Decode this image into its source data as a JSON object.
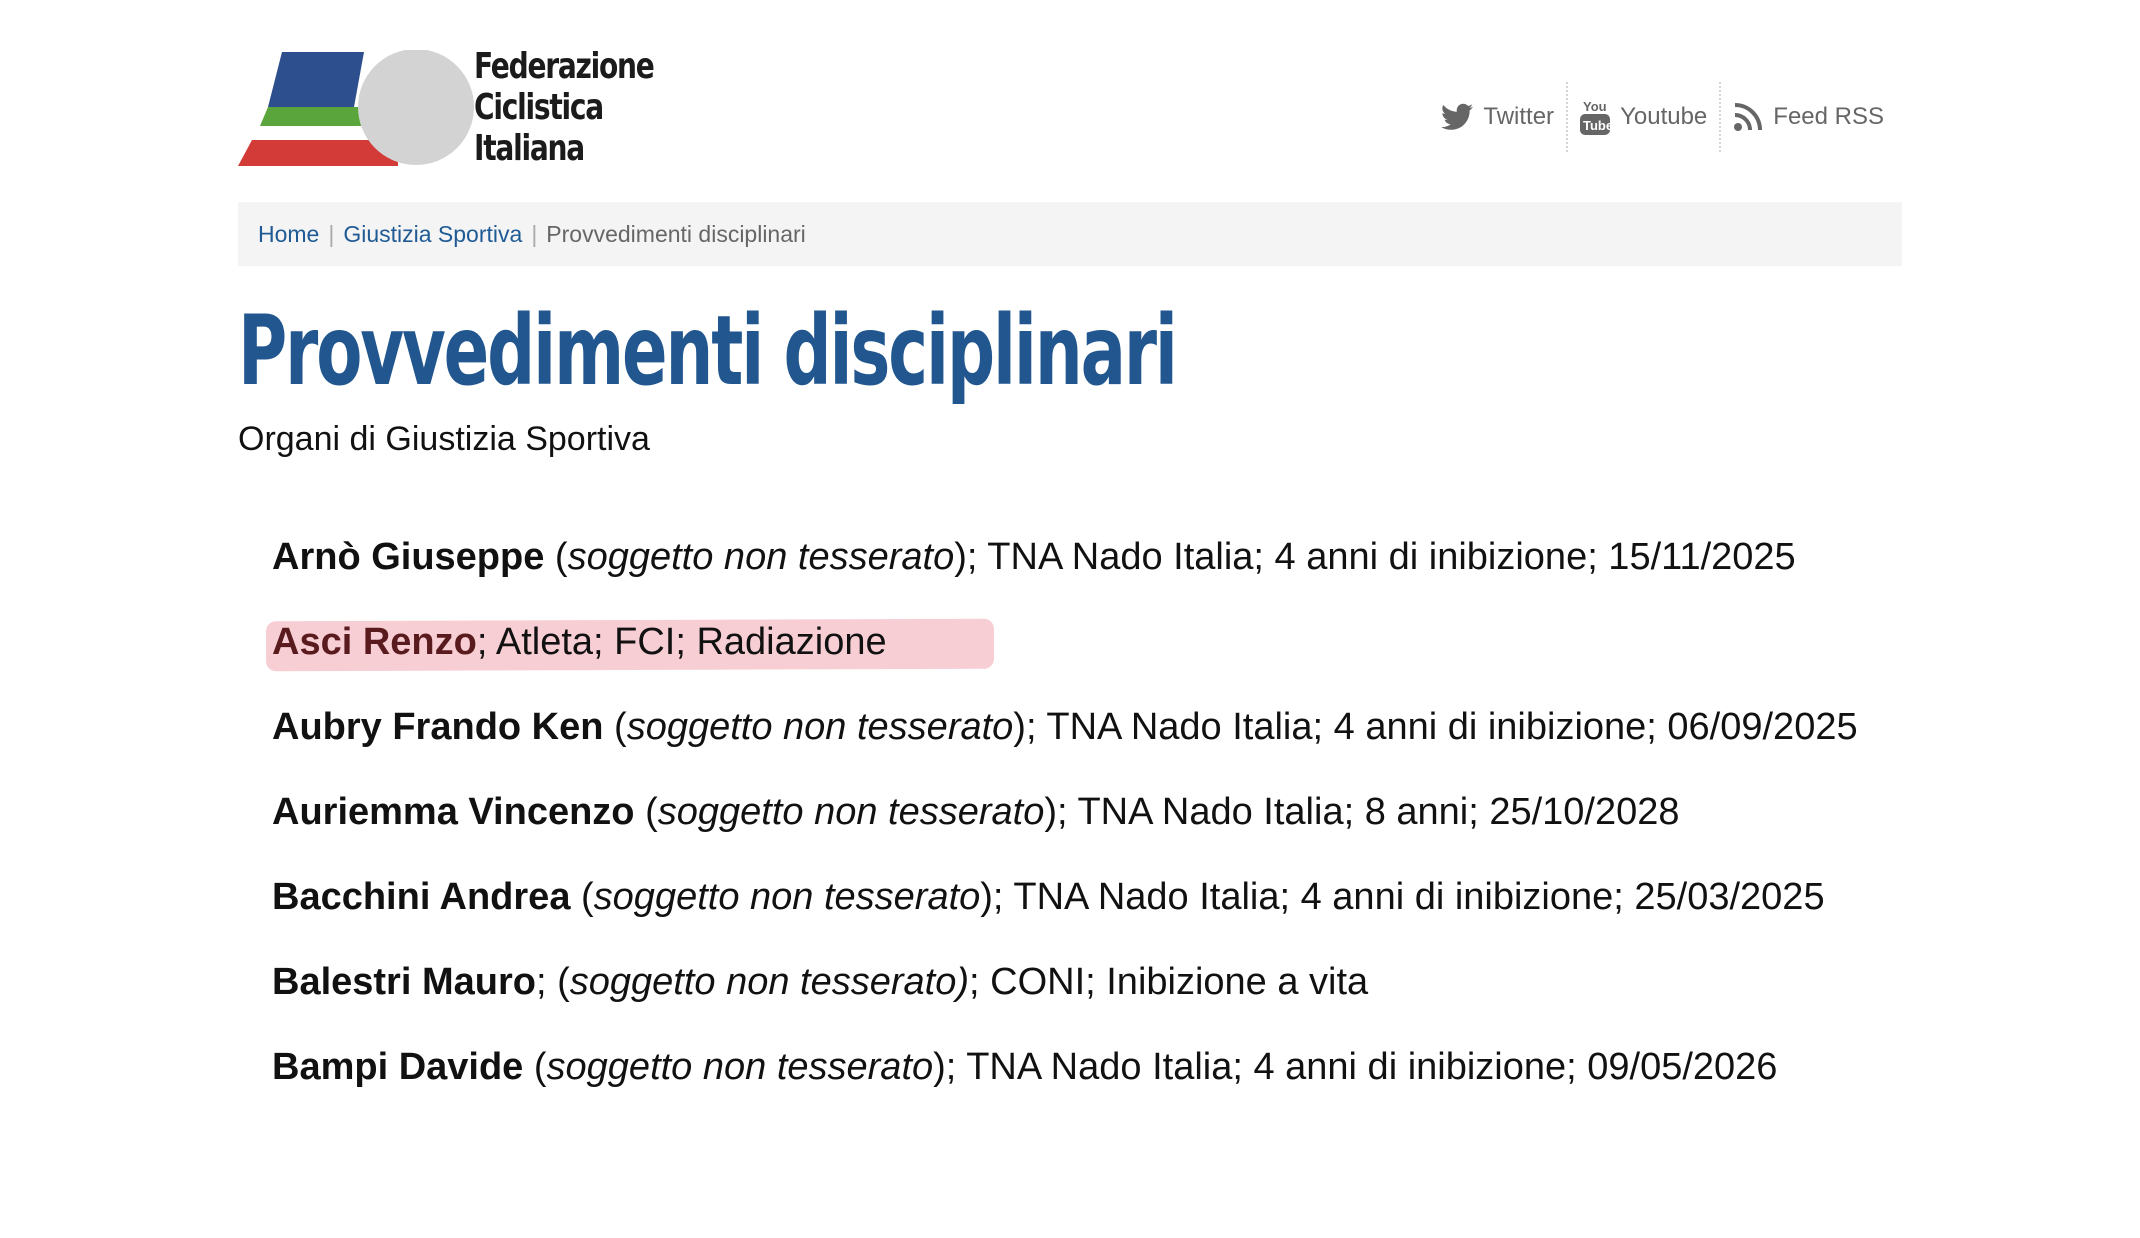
{
  "header": {
    "logo_lines": [
      "Federazione",
      "Ciclistica",
      "Italiana"
    ],
    "social": [
      {
        "label": "Twitter",
        "icon": "twitter-bird-icon"
      },
      {
        "label": "Youtube",
        "icon": "youtube-icon"
      },
      {
        "label": "Feed RSS",
        "icon": "rss-icon"
      }
    ]
  },
  "breadcrumb": {
    "home": "Home",
    "section": "Giustizia Sportiva",
    "current": "Provvedimenti disciplinari",
    "separator": "|"
  },
  "page": {
    "title": "Provvedimenti disciplinari",
    "subtitle": "Organi di Giustizia Sportiva"
  },
  "entries": [
    {
      "name": "Arnò Giuseppe",
      "pre": " (",
      "status": "soggetto non tesserato",
      "post": "); TNA Nado Italia; 4 anni di inibizione; 15/11/2025"
    },
    {
      "name": "Asci Renzo",
      "pre": "; Atleta; FCI; Radiazione",
      "status": "",
      "post": "",
      "highlighted": true
    },
    {
      "name": "Aubry Frando Ken",
      "pre": " (",
      "status": "soggetto non tesserato",
      "post": "); TNA Nado Italia; 4 anni di inibizione; 06/09/2025"
    },
    {
      "name": "Auriemma Vincenzo",
      "pre": " (",
      "status": "soggetto non tesserato",
      "post": "); TNA Nado Italia; 8 anni; 25/10/2028"
    },
    {
      "name": "Bacchini Andrea",
      "pre": " (",
      "status": "soggetto non tesserato",
      "post": "); TNA Nado Italia; 4 anni di inibizione; 25/03/2025"
    },
    {
      "name": "Balestri Mauro",
      "pre": "; (",
      "status": "soggetto non tesserato)",
      "post": "; CONI; Inibizione a vita"
    },
    {
      "name": "Bampi Davide",
      "pre": " (",
      "status": "soggetto non tesserato",
      "post": "); TNA Nado Italia; 4 anni di inibizione; 09/05/2026"
    }
  ],
  "colors": {
    "title_blue": "#21568f",
    "link_blue": "#1f5a95",
    "highlight_pink": "#f6c5cc",
    "logo_blue": "#2d4f8e",
    "logo_green": "#5aa63c",
    "logo_red": "#d33b38",
    "logo_gray": "#d3d3d3"
  }
}
